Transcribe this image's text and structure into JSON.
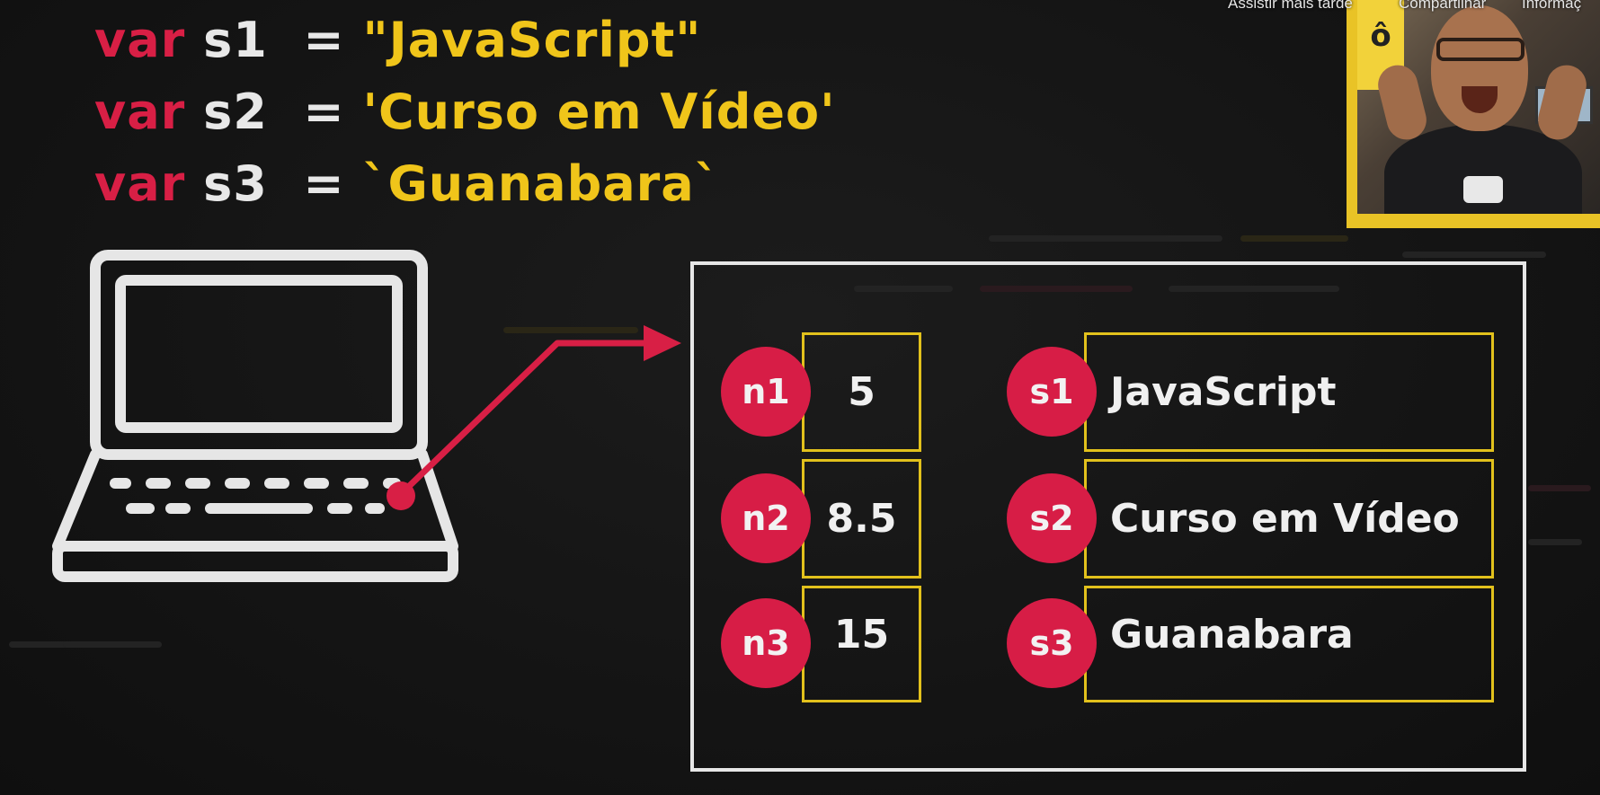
{
  "code": {
    "lines": [
      {
        "keyword": "var",
        "name": "s1",
        "op": "=",
        "value": "\"JavaScript\""
      },
      {
        "keyword": "var",
        "name": "s2",
        "op": "=",
        "value": "'Curso em Vídeo'"
      },
      {
        "keyword": "var",
        "name": "s3",
        "op": "=",
        "value": "`Guanabara`"
      }
    ]
  },
  "overlay": {
    "watch_later": "Assistir mais tarde",
    "share": "Compartilhar",
    "info": "Informaç"
  },
  "webcam": {
    "badge": "ô"
  },
  "memory": {
    "numbers": [
      {
        "label": "n1",
        "value": "5"
      },
      {
        "label": "n2",
        "value": "8.5"
      },
      {
        "label": "n3",
        "value": "15"
      }
    ],
    "strings": [
      {
        "label": "s1",
        "value": "JavaScript"
      },
      {
        "label": "s2",
        "value": "Curso em Vídeo"
      },
      {
        "label": "s3",
        "value": "Guanabara"
      }
    ]
  },
  "colors": {
    "keyword": "#d81f45",
    "string": "#f0c51a",
    "badge": "#d71d46",
    "cell_border": "#e2c11c",
    "box_border": "#e6e6e6",
    "background": "#131313"
  },
  "icons": {
    "laptop": "laptop-icon",
    "arrow": "pointer-arrow"
  }
}
